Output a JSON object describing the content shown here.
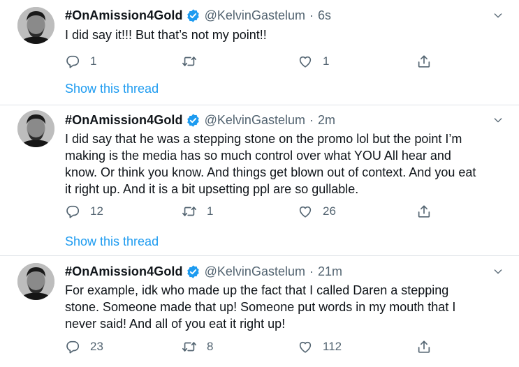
{
  "tweets": [
    {
      "name": "#OnAmission4Gold",
      "handle": "@KelvinGastelum",
      "separator": "·",
      "time": "6s",
      "lines": [
        "I did say it!!! But that’s not my point!!"
      ],
      "replies": "1",
      "retweets": "",
      "likes": "1",
      "show_thread": "Show this thread"
    },
    {
      "name": "#OnAmission4Gold",
      "handle": "@KelvinGastelum",
      "separator": "·",
      "time": "2m",
      "lines": [
        "I did say that he was a stepping stone on the promo lol but the point I’m",
        "making is the media has so much control over what YOU All hear and",
        "know. Or think you know. And things get blown out of context. And you eat",
        "it right up. And it is a bit upsetting ppl are so gullable."
      ],
      "replies": "12",
      "retweets": "1",
      "likes": "26",
      "show_thread": "Show this thread"
    },
    {
      "name": "#OnAmission4Gold",
      "handle": "@KelvinGastelum",
      "separator": "·",
      "time": "21m",
      "lines": [
        "For example, idk who made up the fact that I called Daren a stepping",
        "stone. Someone made that up! Someone put words in my mouth that I",
        "never said! And all of you eat it right up!"
      ],
      "replies": "23",
      "retweets": "8",
      "likes": "112"
    }
  ],
  "icons": {
    "reply": "reply-icon",
    "retweet": "retweet-icon",
    "like": "heart-icon",
    "share": "share-icon",
    "verified": "verified-badge-icon",
    "more": "chevron-down-icon"
  },
  "colors": {
    "accent": "#1d9bf0",
    "secondary_text": "#536471",
    "divider": "#dfe3e8"
  }
}
